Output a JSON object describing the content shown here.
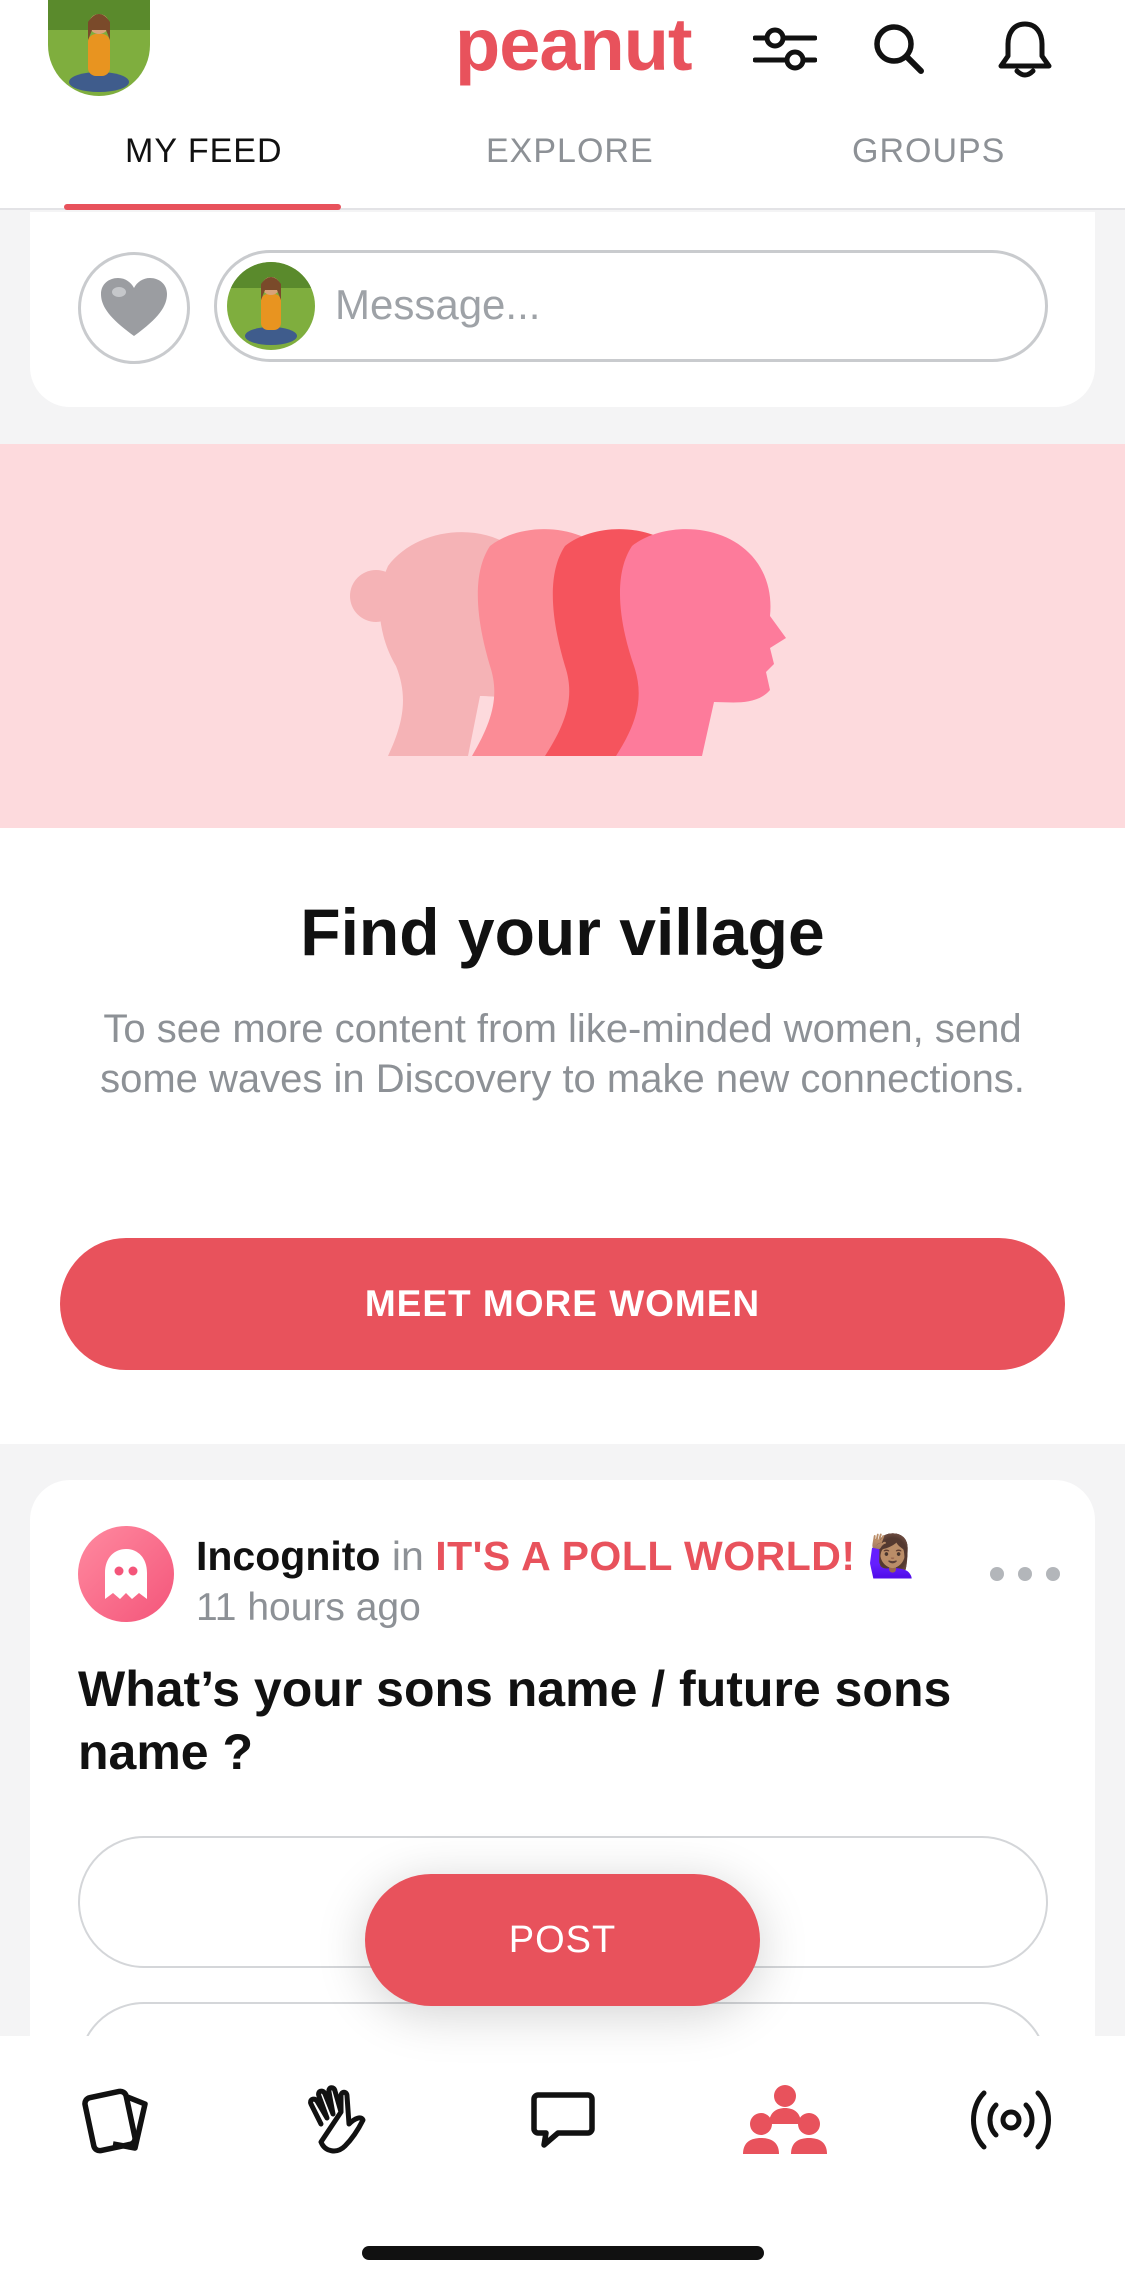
{
  "app": {
    "logo": "peanut"
  },
  "header": {
    "tabs": [
      {
        "label": "MY FEED",
        "active": true
      },
      {
        "label": "EXPLORE",
        "active": false
      },
      {
        "label": "GROUPS",
        "active": false
      }
    ],
    "icons": [
      "filter-sliders-icon",
      "search-icon",
      "bell-icon"
    ]
  },
  "composer": {
    "placeholder": "Message..."
  },
  "promo": {
    "title": "Find your village",
    "text": "To see more content from like-minded women, send some waves in Discovery to make new connections.",
    "button": "MEET MORE WOMEN"
  },
  "post": {
    "author": "Incognito",
    "in_word": "in",
    "group": "IT'S A POLL WORLD!",
    "group_emoji": "🙋🏽‍♀️",
    "time": "11 hours ago",
    "question": "What’s your sons name / future sons name ?"
  },
  "fab": {
    "label": "POST"
  },
  "bottom_nav": [
    "cards-icon",
    "wave-hand-icon",
    "chat-bubble-icon",
    "community-icon",
    "broadcast-icon"
  ],
  "colors": {
    "accent": "#e8525c",
    "banner": "#fddadd",
    "muted": "#8d9196"
  }
}
